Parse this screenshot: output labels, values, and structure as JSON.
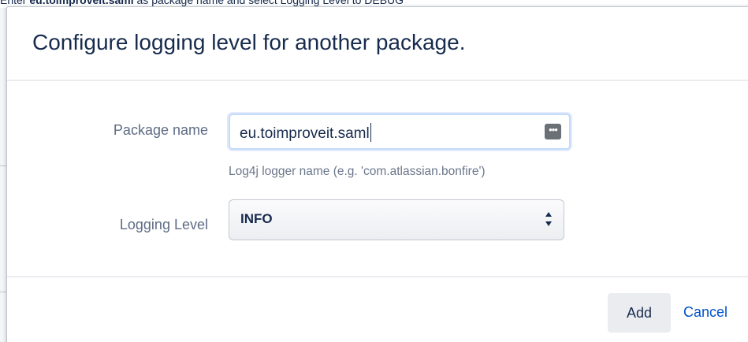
{
  "background": {
    "instruction_prefix": "Enter ",
    "instruction_bold": "eu.toimproveit.saml",
    "instruction_suffix": " as package name and select Logging Level to DEBUG"
  },
  "dialog": {
    "title": "Configure logging level for another package.",
    "package_field": {
      "label": "Package name",
      "value": "eu.toimproveit.saml",
      "help": "Log4j logger name (e.g. 'com.atlassian.bonfire')",
      "dots_icon": "more-dots-icon"
    },
    "level_field": {
      "label": "Logging Level",
      "selected": "INFO"
    },
    "footer": {
      "add_label": "Add",
      "cancel_label": "Cancel"
    }
  },
  "colors": {
    "link": "#0052cc",
    "button_bg": "#ebecf0",
    "text": "#172b4d",
    "muted": "#5e6c84"
  }
}
